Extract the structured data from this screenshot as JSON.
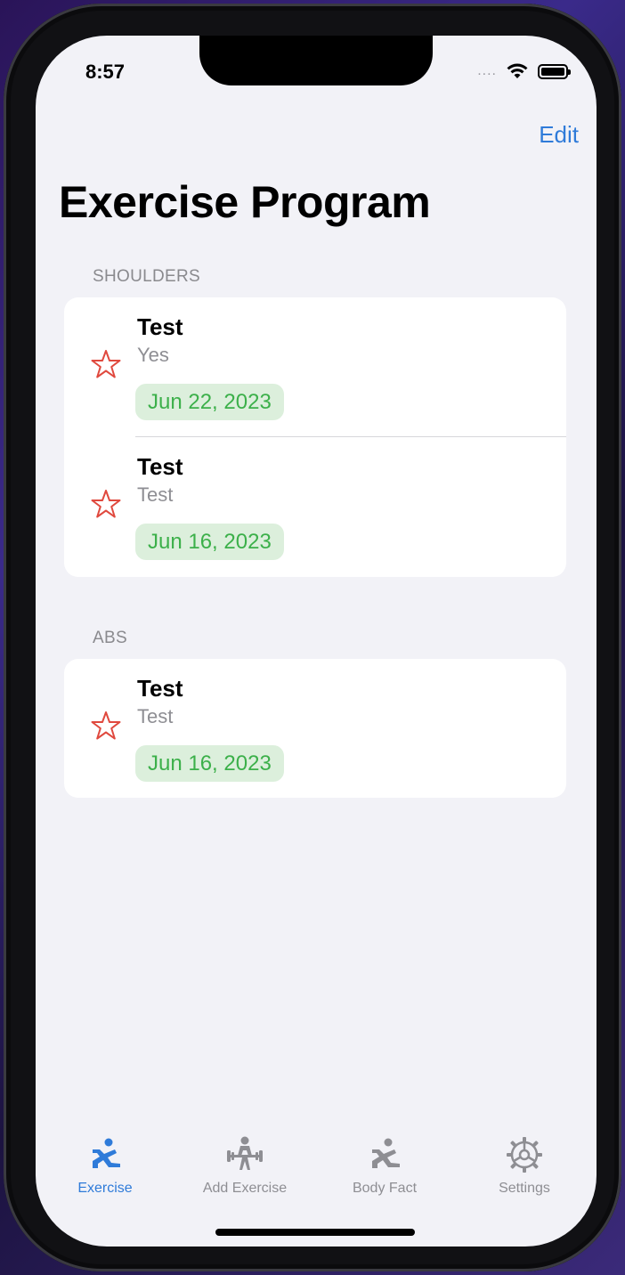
{
  "status_bar": {
    "time": "8:57",
    "signal": "....",
    "wifi_icon": "wifi-icon",
    "battery_icon": "battery-icon"
  },
  "nav": {
    "edit_label": "Edit",
    "title": "Exercise Program"
  },
  "sections": [
    {
      "header": "SHOULDERS",
      "rows": [
        {
          "title": "Test",
          "subtitle": "Yes",
          "date": "Jun 22, 2023",
          "icon": "star-icon"
        },
        {
          "title": "Test",
          "subtitle": "Test",
          "date": "Jun 16, 2023",
          "icon": "star-icon"
        }
      ]
    },
    {
      "header": "ABS",
      "rows": [
        {
          "title": "Test",
          "subtitle": "Test",
          "date": "Jun 16, 2023",
          "icon": "star-icon"
        }
      ]
    }
  ],
  "tabs": [
    {
      "label": "Exercise",
      "icon": "exercise-figure-icon",
      "active": true
    },
    {
      "label": "Add Exercise",
      "icon": "weightlifter-icon",
      "active": false
    },
    {
      "label": "Body Fact",
      "icon": "exercise-figure-icon",
      "active": false
    },
    {
      "label": "Settings",
      "icon": "gear-icon",
      "active": false
    }
  ],
  "colors": {
    "accent": "#2f7bd9",
    "star": "#e0493e",
    "badge_text": "#3cb04a",
    "badge_bg": "#dcefdc",
    "background": "#f2f2f7"
  }
}
